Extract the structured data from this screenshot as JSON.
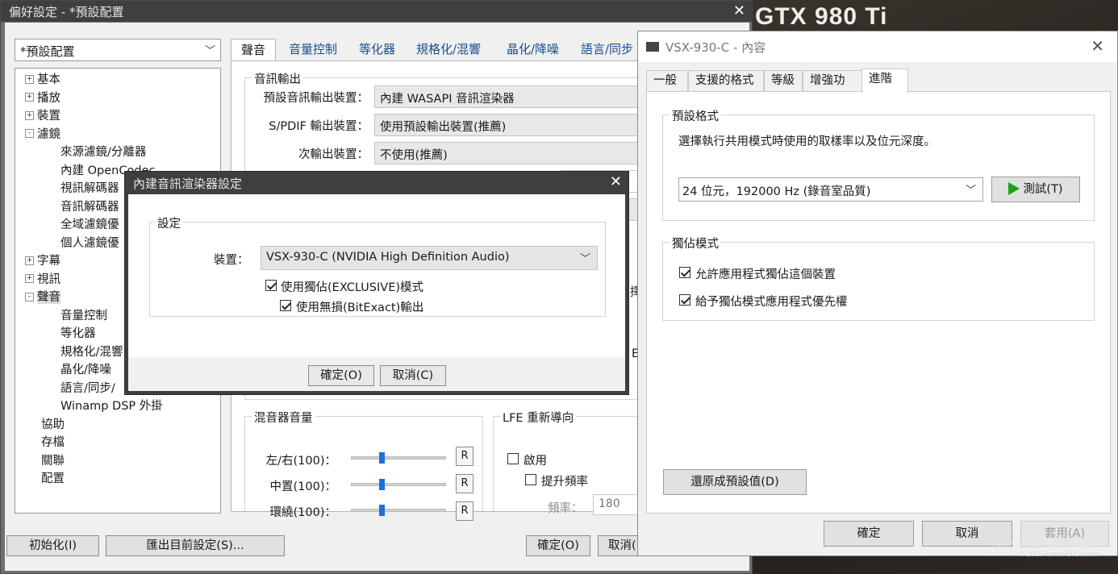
{
  "background": {
    "title": "GTX 980 Ti",
    "watermark_main": "HD.Club 情研視務所",
    "watermark_sub": "© 2015 www.HD.Club.tw"
  },
  "main_window": {
    "title": "偏好設定 - *預設配置",
    "profile": "*預設配置",
    "tree": [
      {
        "label": "基本",
        "level": 0,
        "toggle": "+"
      },
      {
        "label": "播放",
        "level": 0,
        "toggle": "+"
      },
      {
        "label": "裝置",
        "level": 0,
        "toggle": "+"
      },
      {
        "label": "濾鏡",
        "level": 0,
        "toggle": "-"
      },
      {
        "label": "來源濾鏡/分離器",
        "level": 1
      },
      {
        "label": "內建 OpenCodec",
        "level": 1
      },
      {
        "label": "視訊解碼器",
        "level": 1
      },
      {
        "label": "音訊解碼器",
        "level": 1
      },
      {
        "label": "全域濾鏡優",
        "level": 1
      },
      {
        "label": "個人濾鏡優",
        "level": 1
      },
      {
        "label": "字幕",
        "level": 0,
        "toggle": "+"
      },
      {
        "label": "視訊",
        "level": 0,
        "toggle": "+"
      },
      {
        "label": "聲音",
        "level": 0,
        "toggle": "-",
        "selected": true
      },
      {
        "label": "音量控制",
        "level": 1
      },
      {
        "label": "等化器",
        "level": 1
      },
      {
        "label": "規格化/混響",
        "level": 1
      },
      {
        "label": "晶化/降噪",
        "level": 1
      },
      {
        "label": "語言/同步/",
        "level": 1
      },
      {
        "label": "Winamp DSP 外掛",
        "level": 1
      },
      {
        "label": "協助",
        "level": 0
      },
      {
        "label": "存檔",
        "level": 0
      },
      {
        "label": "關聯",
        "level": 0
      },
      {
        "label": "配置",
        "level": 0
      }
    ],
    "tabs": [
      "聲音",
      "音量控制",
      "等化器",
      "規格化/混響",
      "晶化/降噪",
      "語言/同步"
    ],
    "audio_output": {
      "group_title": "音訊輸出",
      "default_label": "預設音訊輸出裝置：",
      "default_value": "內建 WASAPI 音訊渲染器",
      "spdif_label": "S/PDIF 輸出裝置：",
      "spdif_value": "使用預設輸出裝置(推薦)",
      "secondary_label": "次輸出裝置：",
      "secondary_value": "不使用(推薦)"
    },
    "mixer": {
      "group_title": "混音器音量",
      "rows": [
        {
          "label": "左/右(100)：",
          "value": 100,
          "reset": "R"
        },
        {
          "label": "中置(100)：",
          "value": 100,
          "reset": "R"
        },
        {
          "label": "環繞(100)：",
          "value": 100,
          "reset": "R"
        }
      ]
    },
    "lfe": {
      "group_title": "LFE 重新導向",
      "enable_label": "啟用",
      "boost_label": "提升頻率",
      "freq_label": "頻率：",
      "freq_value": "180"
    },
    "buttons": {
      "init": "初始化(I)",
      "export": "匯出目前設定(S)...",
      "ok": "確定(O)",
      "cancel": "取消("
    },
    "partial_labels": {
      "right1": "擇",
      "right2": "E"
    }
  },
  "renderer_dialog": {
    "title": "內建音訊渲染器設定",
    "group_title": "設定",
    "device_label": "裝置：",
    "device_value": "VSX-930-C (NVIDIA High Definition Audio)",
    "exclusive_label": "使用獨佔(EXCLUSIVE)模式",
    "exclusive_checked": true,
    "bitexact_label": "使用無損(BitExact)輸出",
    "bitexact_checked": true,
    "ok": "確定(O)",
    "cancel": "取消(C)"
  },
  "vsx_window": {
    "title": "VSX-930-C - 內容",
    "tabs": [
      "一般",
      "支援的格式",
      "等級",
      "增強功能",
      "進階"
    ],
    "active_tab": "進階",
    "default_format": {
      "group_title": "預設格式",
      "description": "選擇執行共用模式時使用的取樣率以及位元深度。",
      "format_value": "24 位元，192000 Hz (錄音室品質)",
      "test_button": "測試(T)"
    },
    "exclusive": {
      "group_title": "獨佔模式",
      "allow_label": "允許應用程式獨佔這個裝置",
      "allow_checked": true,
      "priority_label": "給予獨佔模式應用程式優先權",
      "priority_checked": true
    },
    "restore_button": "還原成預設值(D)",
    "ok": "確定",
    "cancel": "取消",
    "apply": "套用(A)"
  }
}
